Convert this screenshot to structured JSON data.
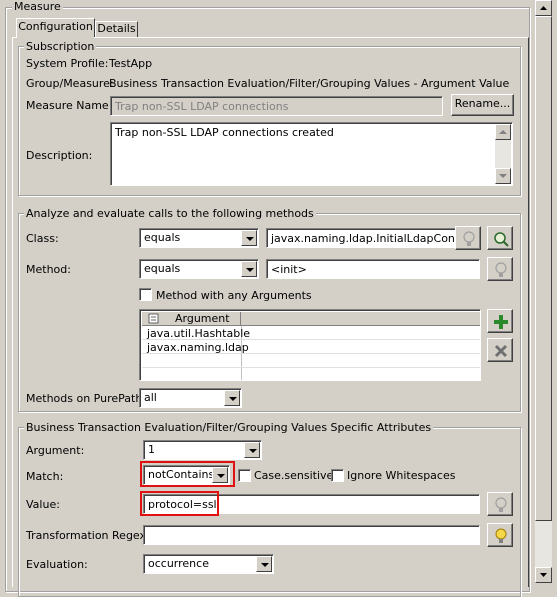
{
  "panel": {
    "title": "Measure"
  },
  "tabs": [
    {
      "label": "Configuration"
    },
    {
      "label": "Details"
    }
  ],
  "subscription": {
    "title": "Subscription",
    "system_profile_label": "System Profile:",
    "system_profile_value": "TestApp",
    "group_label": "Group/Measure:",
    "group_value": "Business Transaction Evaluation/Filter/Grouping Values - Argument Value",
    "measure_name_label": "Measure Name:",
    "measure_name_value": "Trap non-SSL LDAP connections",
    "rename_button": "Rename...",
    "description_label": "Description:",
    "description_value": "Trap non-SSL LDAP connections created"
  },
  "analyze": {
    "title": "Analyze and evaluate calls to the following methods",
    "class_label": "Class:",
    "class_operator": "equals",
    "class_value": "javax.naming.ldap.InitialLdapConte:",
    "method_label": "Method:",
    "method_operator": "equals",
    "method_value": "<init>",
    "any_args_label": "Method with any Arguments",
    "argument_header": "Argument",
    "arguments": [
      "java.util.Hashtable",
      "javax.naming.ldap",
      "",
      ""
    ],
    "purepath_label": "Methods on PurePath:",
    "purepath_value": "all"
  },
  "attributes": {
    "title": "Business Transaction Evaluation/Filter/Grouping Values Specific Attributes",
    "argument_label": "Argument:",
    "argument_value": "1",
    "match_label": "Match:",
    "match_value": "notContains",
    "case_sensitive_label": "Case.sensitive",
    "ignore_whitespace_label": "Ignore Whitespaces",
    "value_label": "Value:",
    "value_value": "protocol=ssl",
    "transform_label": "Transformation Regex:",
    "transform_value": "",
    "evaluation_label": "Evaluation:",
    "evaluation_value": "occurrence"
  },
  "colors": {
    "highlight": "#e01010",
    "window": "#d4d0c8"
  }
}
